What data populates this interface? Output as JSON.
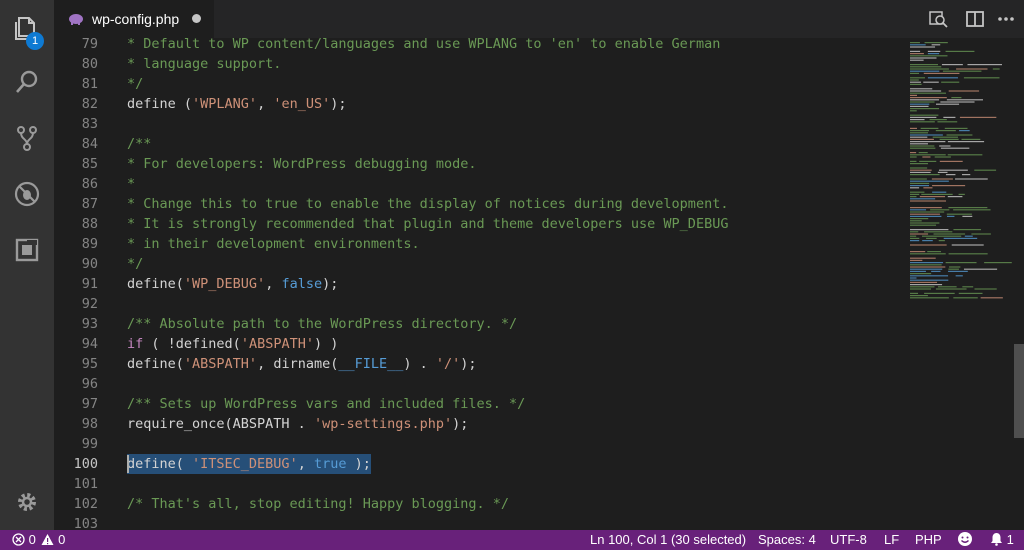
{
  "activity_bar": {
    "items": [
      {
        "icon": "files-icon",
        "badge": "1"
      },
      {
        "icon": "search-icon"
      },
      {
        "icon": "source-control-icon"
      },
      {
        "icon": "debug-icon"
      },
      {
        "icon": "extensions-icon"
      }
    ],
    "bottom": {
      "icon": "gear-icon"
    }
  },
  "tab": {
    "title": "wp-config.php",
    "modified": true,
    "icon": "php-elephant-icon"
  },
  "editor": {
    "active_line": "100",
    "lines": [
      {
        "n": "79",
        "segments": [
          {
            "t": "* Default to WP content/languages and use WPLANG to 'en' to enable German",
            "c": "c"
          }
        ]
      },
      {
        "n": "80",
        "segments": [
          {
            "t": "* language support.",
            "c": "c"
          }
        ]
      },
      {
        "n": "81",
        "segments": [
          {
            "t": "*/",
            "c": "c"
          }
        ]
      },
      {
        "n": "82",
        "segments": [
          {
            "t": "define (",
            "c": "t"
          },
          {
            "t": "'WPLANG'",
            "c": "s"
          },
          {
            "t": ", ",
            "c": "t"
          },
          {
            "t": "'en_US'",
            "c": "s"
          },
          {
            "t": ");",
            "c": "t"
          }
        ]
      },
      {
        "n": "83",
        "segments": []
      },
      {
        "n": "84",
        "segments": [
          {
            "t": "/**",
            "c": "c"
          }
        ]
      },
      {
        "n": "85",
        "segments": [
          {
            "t": "* For developers: WordPress debugging mode.",
            "c": "c"
          }
        ]
      },
      {
        "n": "86",
        "segments": [
          {
            "t": "*",
            "c": "c"
          }
        ]
      },
      {
        "n": "87",
        "segments": [
          {
            "t": "* Change this to true to enable the display of notices during development.",
            "c": "c"
          }
        ]
      },
      {
        "n": "88",
        "segments": [
          {
            "t": "* It is strongly recommended that plugin and theme developers use WP_DEBUG",
            "c": "c"
          }
        ]
      },
      {
        "n": "89",
        "segments": [
          {
            "t": "* in their development environments.",
            "c": "c"
          }
        ]
      },
      {
        "n": "90",
        "segments": [
          {
            "t": "*/",
            "c": "c"
          }
        ]
      },
      {
        "n": "91",
        "segments": [
          {
            "t": "define(",
            "c": "t"
          },
          {
            "t": "'WP_DEBUG'",
            "c": "s"
          },
          {
            "t": ", ",
            "c": "t"
          },
          {
            "t": "false",
            "c": "k"
          },
          {
            "t": ");",
            "c": "t"
          }
        ]
      },
      {
        "n": "92",
        "segments": []
      },
      {
        "n": "93",
        "segments": [
          {
            "t": "/** Absolute path to the WordPress directory. */",
            "c": "c"
          }
        ]
      },
      {
        "n": "94",
        "segments": [
          {
            "t": "if",
            "c": "kc"
          },
          {
            "t": " ( !defined(",
            "c": "t"
          },
          {
            "t": "'ABSPATH'",
            "c": "s"
          },
          {
            "t": ") )",
            "c": "t"
          }
        ]
      },
      {
        "n": "95",
        "segments": [
          {
            "t": "define(",
            "c": "t"
          },
          {
            "t": "'ABSPATH'",
            "c": "s"
          },
          {
            "t": ", dirname(",
            "c": "t"
          },
          {
            "t": "__FILE__",
            "c": "k"
          },
          {
            "t": ") . ",
            "c": "t"
          },
          {
            "t": "'/'",
            "c": "s"
          },
          {
            "t": ");",
            "c": "t"
          }
        ]
      },
      {
        "n": "96",
        "segments": []
      },
      {
        "n": "97",
        "segments": [
          {
            "t": "/** Sets up WordPress vars and included files. */",
            "c": "c"
          }
        ]
      },
      {
        "n": "98",
        "segments": [
          {
            "t": "require_once(ABSPATH . ",
            "c": "t"
          },
          {
            "t": "'wp-settings.php'",
            "c": "s"
          },
          {
            "t": ");",
            "c": "t"
          }
        ]
      },
      {
        "n": "99",
        "segments": []
      },
      {
        "n": "100",
        "selected": true,
        "segments": [
          {
            "t": "define( ",
            "c": "t"
          },
          {
            "t": "'ITSEC_DEBUG'",
            "c": "s"
          },
          {
            "t": ", ",
            "c": "t"
          },
          {
            "t": "true",
            "c": "k"
          },
          {
            "t": " );",
            "c": "t"
          }
        ]
      },
      {
        "n": "101",
        "segments": []
      },
      {
        "n": "102",
        "segments": [
          {
            "t": "/* That's all, stop editing! Happy blogging. */",
            "c": "c"
          }
        ]
      },
      {
        "n": "103",
        "segments": []
      }
    ]
  },
  "status_bar": {
    "errors": "0",
    "warnings": "0",
    "position": "Ln 100, Col 1 (30 selected)",
    "indent": "Spaces: 4",
    "encoding": "UTF-8",
    "eol": "LF",
    "language": "PHP",
    "notifications": "1",
    "feedback_icon": "smiley-icon",
    "bell_icon": "bell-icon"
  },
  "colors": {
    "status_bar": "#68217a",
    "activity_bar": "#333333",
    "editor_bg": "#1e1e1e",
    "selection": "#264f78",
    "badge": "#0e7ad3"
  }
}
